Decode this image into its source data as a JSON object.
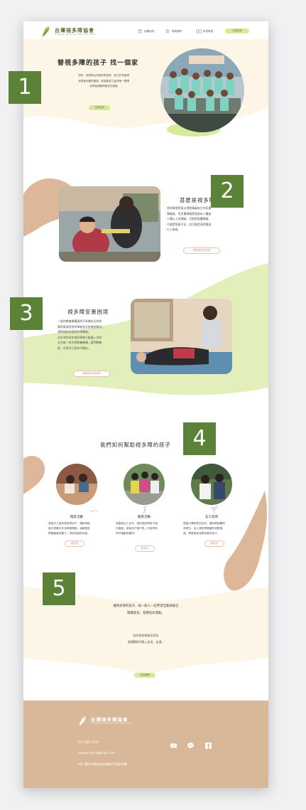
{
  "nav": {
    "logo_cn": "台灣視多障協會",
    "logo_en": "TAIWAN ASSOCIATION FOR MDVI",
    "items": [
      {
        "label": "認識協會",
        "icon": "people-icon"
      },
      {
        "label": "服務類別",
        "icon": "hands-icon"
      },
      {
        "label": "影音專區",
        "icon": "video-icon"
      }
    ],
    "support_label": "立即支持"
  },
  "hero": {
    "title": "替視多障的孩子 找一個家",
    "text": [
      "您好，我們是台灣視多障協會，致力於突破視",
      "多障者安置的困境，希望能成立臺灣第一間視",
      "多障者照顧與陪伴的家園"
    ],
    "button": "立即支持"
  },
  "what": {
    "title": "甚麼是視多障",
    "text": [
      "視多障便是指以視覺障礙為主的多重",
      "障礙者，而多重障礙是指具有二種或",
      "二種以上的障礙，可能是肢體障礙、",
      "可能是智能不足，也可能是同時兼具",
      "以上幾者。"
    ],
    "button": "看看更多的說明"
  },
  "dilemma": {
    "title": "視多障安置困境",
    "text": [
      "一般的教養機構通常不具備充足的知",
      "識與資源對視多障者各式各樣的情況，",
      "通常婉拒收容成年視障者。",
      "全台灣的成年視多障者只能進入目前",
      "全台唯一的住宿教養機構—惠明教養",
      "院，目前早已是供不應求。"
    ],
    "button": "看看更多的說明"
  },
  "help": {
    "title": "我們如何幫助視多障的孩子",
    "cards": [
      {
        "title": "喘息活動",
        "text": [
          "透過志工陪伴視多障孩子，讓家長能",
          "進行簡單手作及學員課程，減輕視多",
          "障照顧者的壓力，得到短暫的休息。"
        ],
        "button": "看更多"
      },
      {
        "title": "路跑活動",
        "text": [
          "與路跑志工合作，陪伴視多障孩子進",
          "行路跑，即使孩子看不見，仍能享有",
          "好好運動的權利！"
        ],
        "button": "看更多"
      },
      {
        "title": "志工培育",
        "text": [
          "透過大專院校的合作，讓特教相關科",
          "系學生、走入視多障照顧的真實場",
          "域，學習陪伴這群特殊的孩子。"
        ],
        "button": "看更多"
      }
    ]
  },
  "cta": {
    "line1": "讓視多障的孩子，與一般人一起學習互動與融合",
    "line2": "健康成長，發揮生命潛能。",
    "line3": "陪伴視多障者及家長",
    "line4": "這條艱鉅的路上走長、走遠。",
    "button": "支持我們"
  },
  "footer": {
    "logo_cn": "台灣視多障協會",
    "logo_en": "TAIWAN ASSOCIATION FOR MDVI",
    "phone": "04 2265 3153",
    "email": "taiwan.mdvi@gmail.com",
    "address": "402 臺中市南區忠明南路758號10樓"
  },
  "annotations": [
    "1",
    "2",
    "3",
    "4",
    "5"
  ],
  "colors": {
    "accent_green": "#d8ea9a",
    "cream": "#fdf6e6",
    "tan": "#d8b898",
    "step_box": "#5b8237"
  }
}
